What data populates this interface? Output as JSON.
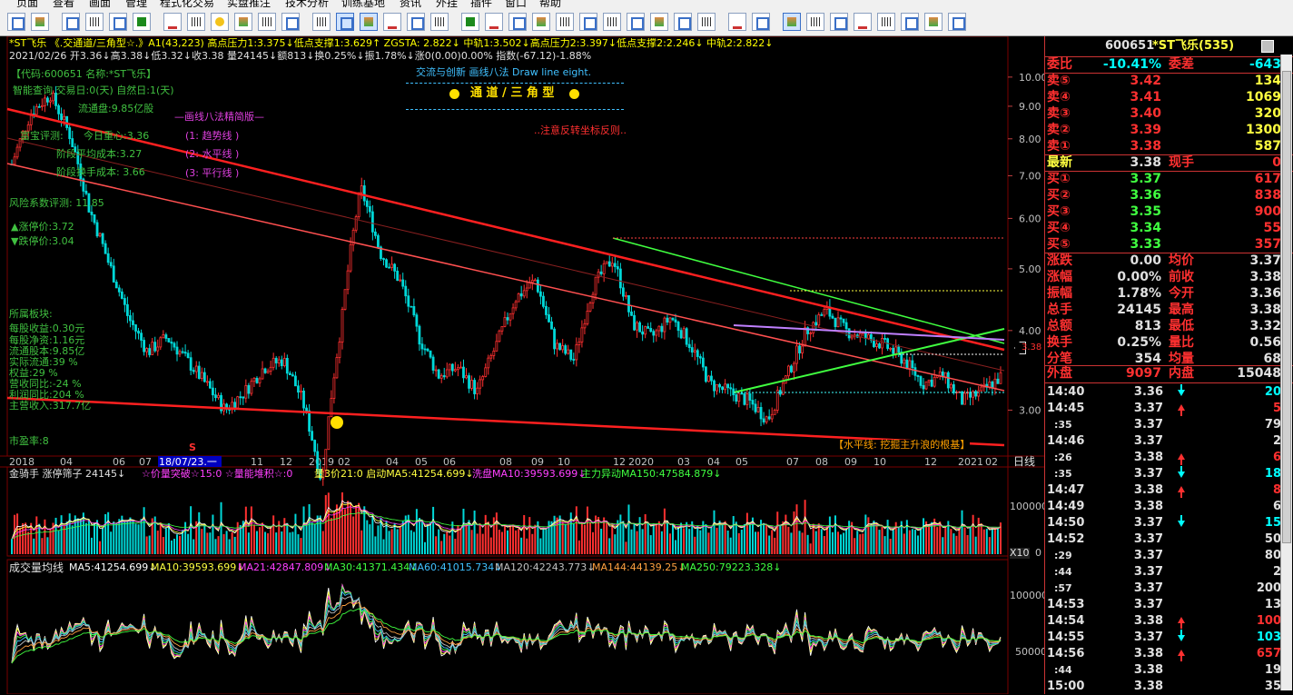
{
  "menu": [
    "页面",
    "查看",
    "画面",
    "管理",
    "程式化交易",
    "实盘推注",
    "技术分析",
    "训练基地",
    "资讯",
    "外挂",
    "插件",
    "窗口",
    "帮助"
  ],
  "chart_header": {
    "title_line": "*ST飞乐 《.交通道/三角型☆.》A1(43,223) 高点压力1:3.375↓低点支撑1:3.629↑ ZGSTA: 2.822↓ 中轨1:3.502↓高点压力2:3.397↓低点支撑2:2.246↓ 中轨2:2.822↓",
    "ohlc_line": "2021/02/26 开3.36↓高3.38↓低3.32↓收3.38 量24145↓额813↓换0.25%↓振1.78%↓涨0(0.00)0.00% 指数(-67.12)-1.88%",
    "code_name": "【代码:600651 名称:*ST飞乐】",
    "smart_query": "智能查询  交易日:0(天) 自然日:1(天)",
    "float_cap": "流通盘:9.85亿股",
    "wealth_eval": "富宝评测:",
    "today_center": "今日重心:3.36",
    "avg_cost": "阶段平均成本:3.27",
    "turnover_cost": "阶段换手成本:  3.66",
    "risk_coef": "风险系数评测:  11.85",
    "limit_up": "▲涨停价:3.72",
    "limit_down": "▼跌停价:3.04",
    "sector": "所属板块:",
    "eps": "每股收益:0.30元",
    "nav": "每股净资:1.16元",
    "float_equity": "流通股本:9.85亿",
    "actual_float": "实际流通:39 %",
    "weight": "权益:29 %",
    "rev_yoy": "营收同比:-24 %",
    "profit_yoy": "利润同比:204 %",
    "main_income": "主营收入:317.7亿",
    "pe": "市盈率:8",
    "method_title": "—画线八法精简版—",
    "method1": "(1: 趋势线 )",
    "method2": "(2: 水平线 )",
    "method3": "(3: 平行线 )",
    "box_top": "交流与创新  画线八法  Draw line eight.",
    "box_title": "通 道 / 三 角 型",
    "note": "..注意反转坐标反则..",
    "horizontal_note": "【水平线: 挖掘主升浪的根基】",
    "price_tag": "3.38",
    "s_mark": "S"
  },
  "price_axis": [
    "10.00",
    "9.00",
    "8.00",
    "7.00",
    "6.00",
    "5.00",
    "4.00",
    "3.00"
  ],
  "date_axis": [
    "2018",
    "04",
    "06",
    "07",
    "18/07/23.一",
    "11",
    "12",
    "2019",
    "02",
    "04",
    "05",
    "06",
    "08",
    "09",
    "10",
    "12",
    "2020",
    "03",
    "04",
    "05",
    "07",
    "08",
    "09",
    "10",
    "12",
    "2021",
    "02"
  ],
  "period_label": "日线",
  "vol_panel": {
    "header_a": "金骑手  涨停筛子 24145↓",
    "header_b": "☆价量突破☆15:0 ☆量能堆积☆:0",
    "header_c": "量3价21:0 启动MA5:41254.699↓",
    "header_d": "洗盘MA10:39593.699↓",
    "header_e": "主力异动MA150:47584.879↓",
    "axis_top": "100000",
    "axis_unit": "X10",
    "axis_zero": "0"
  },
  "ma_panel": {
    "title": "成交量均线",
    "ma5": "MA5:41254.699↓",
    "ma10": "MA10:39593.699↓",
    "ma21": "MA21:42847.809↓",
    "ma30": "MA30:41371.434↓",
    "ma60": "MA60:41015.734↓",
    "ma120": "MA120:42243.773↓",
    "ma144": "MA144:44139.25↓",
    "ma250": "MA250:79223.328↓",
    "axis_top": "100000",
    "axis_mid": "50000"
  },
  "quote": {
    "code": "600651",
    "name": "*ST飞乐(535)",
    "ratio_label": "委比",
    "ratio": "-10.41%",
    "diff_label": "委差",
    "diff": "-643",
    "asks": [
      {
        "label": "卖⑤",
        "price": "3.42",
        "vol": "134"
      },
      {
        "label": "卖④",
        "price": "3.41",
        "vol": "1069"
      },
      {
        "label": "卖③",
        "price": "3.40",
        "vol": "320"
      },
      {
        "label": "卖②",
        "price": "3.39",
        "vol": "1300"
      },
      {
        "label": "卖①",
        "price": "3.38",
        "vol": "587"
      }
    ],
    "latest_label": "最新",
    "latest": "3.38",
    "cur_label": "现手",
    "cur": "0",
    "bids": [
      {
        "label": "买①",
        "price": "3.37",
        "vol": "617"
      },
      {
        "label": "买②",
        "price": "3.36",
        "vol": "838"
      },
      {
        "label": "买③",
        "price": "3.35",
        "vol": "900"
      },
      {
        "label": "买④",
        "price": "3.34",
        "vol": "55"
      },
      {
        "label": "买⑤",
        "price": "3.33",
        "vol": "357"
      }
    ],
    "stats": [
      {
        "l1": "涨跌",
        "v1": "0.00",
        "l2": "均价",
        "v2": "3.37"
      },
      {
        "l1": "涨幅",
        "v1": "0.00%",
        "l2": "前收",
        "v2": "3.38"
      },
      {
        "l1": "振幅",
        "v1": "1.78%",
        "l2": "今开",
        "v2": "3.36"
      },
      {
        "l1": "总手",
        "v1": "24145",
        "l2": "最高",
        "v2": "3.38"
      },
      {
        "l1": "总额",
        "v1": "813",
        "l2": "最低",
        "v2": "3.32"
      },
      {
        "l1": "换手",
        "v1": "0.25%",
        "l2": "量比",
        "v2": "0.56"
      },
      {
        "l1": "分笔",
        "v1": "354",
        "l2": "均量",
        "v2": "68"
      }
    ],
    "outer_label": "外盘",
    "outer": "9097",
    "inner_label": "内盘",
    "inner": "15048",
    "ticks": [
      {
        "t": "14:40",
        "p": "3.36",
        "d": "down",
        "v": "20"
      },
      {
        "t": "14:45",
        "p": "3.37",
        "d": "up",
        "v": "5"
      },
      {
        "t": ":35",
        "p": "3.37",
        "d": "",
        "v": "79"
      },
      {
        "t": "14:46",
        "p": "3.37",
        "d": "",
        "v": "2"
      },
      {
        "t": ":26",
        "p": "3.38",
        "d": "up",
        "v": "6"
      },
      {
        "t": ":35",
        "p": "3.37",
        "d": "down",
        "v": "18"
      },
      {
        "t": "14:47",
        "p": "3.38",
        "d": "up",
        "v": "8"
      },
      {
        "t": "14:49",
        "p": "3.38",
        "d": "",
        "v": "6"
      },
      {
        "t": "14:50",
        "p": "3.37",
        "d": "down",
        "v": "15"
      },
      {
        "t": "14:52",
        "p": "3.37",
        "d": "",
        "v": "50"
      },
      {
        "t": ":29",
        "p": "3.37",
        "d": "",
        "v": "80"
      },
      {
        "t": ":44",
        "p": "3.37",
        "d": "",
        "v": "2"
      },
      {
        "t": ":57",
        "p": "3.37",
        "d": "",
        "v": "200"
      },
      {
        "t": "14:53",
        "p": "3.37",
        "d": "",
        "v": "13"
      },
      {
        "t": "14:54",
        "p": "3.38",
        "d": "up",
        "v": "100"
      },
      {
        "t": "14:55",
        "p": "3.37",
        "d": "down",
        "v": "103"
      },
      {
        "t": "14:56",
        "p": "3.38",
        "d": "up",
        "v": "657"
      },
      {
        "t": ":44",
        "p": "3.38",
        "d": "",
        "v": "19"
      },
      {
        "t": "15:00",
        "p": "3.38",
        "d": "",
        "v": "35"
      }
    ]
  },
  "chart_data": {
    "type": "line",
    "title": "",
    "note": "",
    "ylim": [
      2.6,
      10.5
    ],
    "series_name": "",
    "close": [
      7.3,
      8.8,
      9.4,
      8.1,
      6.2,
      5.1,
      4.2,
      3.7,
      3.9,
      3.6,
      3.3,
      3.0,
      3.2,
      3.5,
      3.6,
      3.1,
      2.3,
      4.1,
      6.7,
      5.3,
      4.8,
      3.9,
      3.4,
      3.5,
      3.2,
      3.8,
      4.5,
      4.8,
      3.8,
      3.6,
      4.7,
      5.2,
      4.1,
      3.9,
      4.2,
      3.8,
      3.3,
      3.2,
      3.1,
      2.9,
      3.4,
      4.0,
      4.3,
      4.0,
      3.9,
      3.8,
      3.6,
      3.3,
      3.4,
      3.1,
      3.2,
      3.38
    ]
  }
}
